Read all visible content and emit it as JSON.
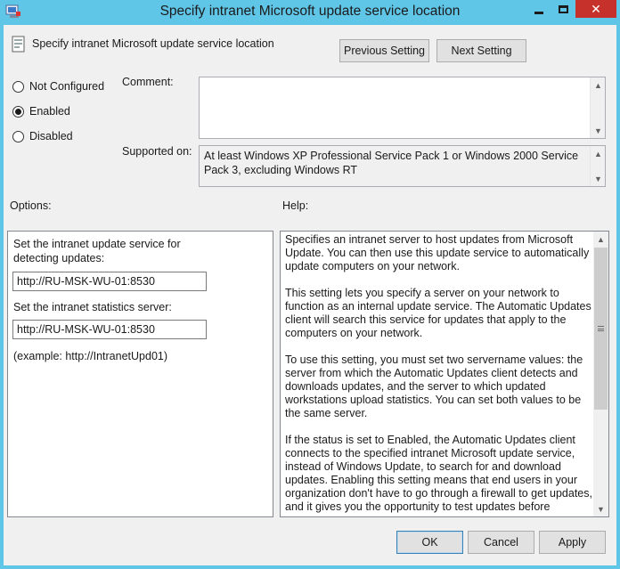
{
  "window": {
    "title": "Specify intranet Microsoft update service location",
    "minimize_icon": "minimize-icon",
    "maximize_icon": "maximize-icon",
    "close_glyph": "✕",
    "close_color": "#c7312c",
    "frame_color": "#5fc6e8"
  },
  "header": {
    "policy_title": "Specify intranet Microsoft update service location",
    "previous_label": "Previous Setting",
    "next_label": "Next Setting"
  },
  "state": {
    "options": [
      {
        "label": "Not Configured",
        "selected": false
      },
      {
        "label": "Enabled",
        "selected": true
      },
      {
        "label": "Disabled",
        "selected": false
      }
    ]
  },
  "comment": {
    "label": "Comment:",
    "value": ""
  },
  "supported": {
    "label": "Supported on:",
    "value": "At least Windows XP Professional Service Pack 1 or Windows 2000 Service Pack 3, excluding Windows RT"
  },
  "options_section": {
    "heading": "Options:",
    "detect_label": "Set the intranet update service for detecting updates:",
    "detect_value": "http://RU-MSK-WU-01:8530",
    "stats_label": "Set the intranet statistics server:",
    "stats_value": "http://RU-MSK-WU-01:8530",
    "example": "(example: http://IntranetUpd01)"
  },
  "help_section": {
    "heading": "Help:",
    "paragraphs": [
      "Specifies an intranet server to host updates from Microsoft Update. You can then use this update service to automatically update computers on your network.",
      "This setting lets you specify a server on your network to function as an internal update service. The Automatic Updates client will search this service for updates that apply to the computers on your network.",
      "To use this setting, you must set two servername values: the server from which the Automatic Updates client detects and downloads updates, and the server to which updated workstations upload statistics. You can set both values to be the same server.",
      "If the status is set to Enabled, the Automatic Updates client connects to the specified intranet Microsoft update service, instead of Windows Update, to search for and download updates. Enabling this setting means that end users in your organization don't have to go through a firewall to get updates, and it gives you the opportunity to test updates before deploying"
    ]
  },
  "footer": {
    "ok_label": "OK",
    "cancel_label": "Cancel",
    "apply_label": "Apply"
  }
}
